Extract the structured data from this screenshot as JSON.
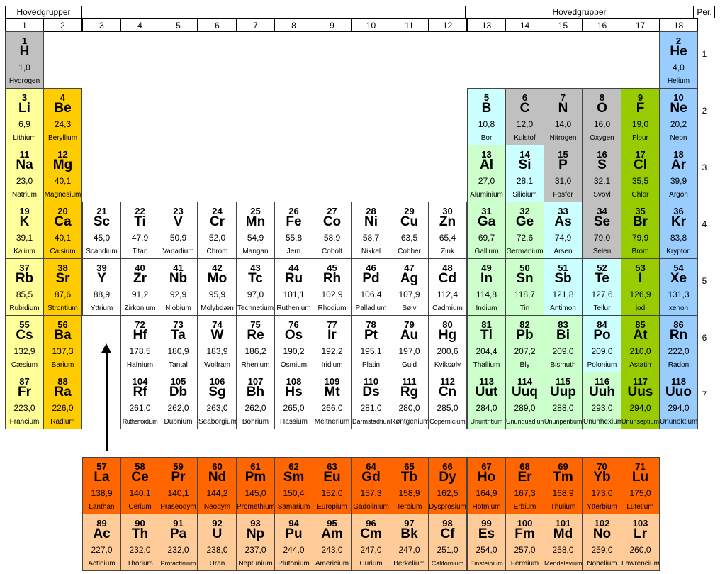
{
  "headers": {
    "left_group": "Hovedgrupper",
    "right_group": "Hovedgrupper",
    "period": "Per."
  },
  "groups": [
    "1",
    "2",
    "3",
    "4",
    "5",
    "6",
    "7",
    "8",
    "9",
    "10",
    "11",
    "12",
    "13",
    "14",
    "15",
    "16",
    "17",
    "18"
  ],
  "periods": [
    "1",
    "2",
    "3",
    "4",
    "5",
    "6",
    "7"
  ],
  "colors": {
    "hydrogen": "#c0c0c0",
    "alkali": "#ffff99",
    "alkaline": "#ffcc00",
    "transition": "#ffffff",
    "boron_group": "#ccffff",
    "metalloid": "#c0c0c0",
    "poor_metal": "#ccffcc",
    "halogen": "#99cc00",
    "noble": "#99ccff",
    "lanthanide": "#ff6600",
    "actinide": "#ffcc99"
  },
  "elements": [
    {
      "n": "1",
      "s": "H",
      "m": "1,0",
      "name": "Hydrogen",
      "g": 1,
      "p": 1,
      "c": "hydrogen"
    },
    {
      "n": "2",
      "s": "He",
      "m": "4,0",
      "name": "Helium",
      "g": 18,
      "p": 1,
      "c": "noble"
    },
    {
      "n": "3",
      "s": "Li",
      "m": "6,9",
      "name": "Lithium",
      "g": 1,
      "p": 2,
      "c": "alkali"
    },
    {
      "n": "4",
      "s": "Be",
      "m": "24,3",
      "name": "Beryllium",
      "g": 2,
      "p": 2,
      "c": "alkaline"
    },
    {
      "n": "5",
      "s": "B",
      "m": "10,8",
      "name": "Bor",
      "g": 13,
      "p": 2,
      "c": "boron_group"
    },
    {
      "n": "6",
      "s": "C",
      "m": "12,0",
      "name": "Kulstof",
      "g": 14,
      "p": 2,
      "c": "metalloid"
    },
    {
      "n": "7",
      "s": "N",
      "m": "14,0",
      "name": "Nitrogen",
      "g": 15,
      "p": 2,
      "c": "metalloid"
    },
    {
      "n": "8",
      "s": "O",
      "m": "16,0",
      "name": "Oxygen",
      "g": 16,
      "p": 2,
      "c": "metalloid"
    },
    {
      "n": "9",
      "s": "F",
      "m": "19,0",
      "name": "Flour",
      "g": 17,
      "p": 2,
      "c": "halogen"
    },
    {
      "n": "10",
      "s": "Ne",
      "m": "20,2",
      "name": "Neon",
      "g": 18,
      "p": 2,
      "c": "noble"
    },
    {
      "n": "11",
      "s": "Na",
      "m": "23,0",
      "name": "Natrium",
      "g": 1,
      "p": 3,
      "c": "alkali"
    },
    {
      "n": "12",
      "s": "Mg",
      "m": "40,1",
      "name": "Magnesium",
      "g": 2,
      "p": 3,
      "c": "alkaline"
    },
    {
      "n": "13",
      "s": "Al",
      "m": "27,0",
      "name": "Aluminium",
      "g": 13,
      "p": 3,
      "c": "poor_metal"
    },
    {
      "n": "14",
      "s": "Si",
      "m": "28,1",
      "name": "Silicium",
      "g": 14,
      "p": 3,
      "c": "boron_group"
    },
    {
      "n": "15",
      "s": "P",
      "m": "31,0",
      "name": "Fosfor",
      "g": 15,
      "p": 3,
      "c": "metalloid"
    },
    {
      "n": "16",
      "s": "S",
      "m": "32,1",
      "name": "Svovl",
      "g": 16,
      "p": 3,
      "c": "metalloid"
    },
    {
      "n": "17",
      "s": "Cl",
      "m": "35,5",
      "name": "Chlor",
      "g": 17,
      "p": 3,
      "c": "halogen"
    },
    {
      "n": "18",
      "s": "Ar",
      "m": "39,9",
      "name": "Argon",
      "g": 18,
      "p": 3,
      "c": "noble"
    },
    {
      "n": "19",
      "s": "K",
      "m": "39,1",
      "name": "Kalium",
      "g": 1,
      "p": 4,
      "c": "alkali"
    },
    {
      "n": "20",
      "s": "Ca",
      "m": "40,1",
      "name": "Calsium",
      "g": 2,
      "p": 4,
      "c": "alkaline"
    },
    {
      "n": "21",
      "s": "Sc",
      "m": "45,0",
      "name": "Scandium",
      "g": 3,
      "p": 4,
      "c": "transition"
    },
    {
      "n": "22",
      "s": "Ti",
      "m": "47,9",
      "name": "Titan",
      "g": 4,
      "p": 4,
      "c": "transition"
    },
    {
      "n": "23",
      "s": "V",
      "m": "50,9",
      "name": "Vanadium",
      "g": 5,
      "p": 4,
      "c": "transition"
    },
    {
      "n": "24",
      "s": "Cr",
      "m": "52,0",
      "name": "Chrom",
      "g": 6,
      "p": 4,
      "c": "transition"
    },
    {
      "n": "25",
      "s": "Mn",
      "m": "54,9",
      "name": "Mangan",
      "g": 7,
      "p": 4,
      "c": "transition"
    },
    {
      "n": "26",
      "s": "Fe",
      "m": "55,8",
      "name": "Jern",
      "g": 8,
      "p": 4,
      "c": "transition"
    },
    {
      "n": "27",
      "s": "Co",
      "m": "58,9",
      "name": "Cobolt",
      "g": 9,
      "p": 4,
      "c": "transition"
    },
    {
      "n": "28",
      "s": "Ni",
      "m": "58,7",
      "name": "Nikkel",
      "g": 10,
      "p": 4,
      "c": "transition"
    },
    {
      "n": "29",
      "s": "Cu",
      "m": "63,5",
      "name": "Cobber",
      "g": 11,
      "p": 4,
      "c": "transition"
    },
    {
      "n": "30",
      "s": "Zn",
      "m": "65,4",
      "name": "Zink",
      "g": 12,
      "p": 4,
      "c": "transition"
    },
    {
      "n": "31",
      "s": "Ga",
      "m": "69,7",
      "name": "Gallium",
      "g": 13,
      "p": 4,
      "c": "poor_metal"
    },
    {
      "n": "32",
      "s": "Ge",
      "m": "72,6",
      "name": "Germanium",
      "g": 14,
      "p": 4,
      "c": "poor_metal"
    },
    {
      "n": "33",
      "s": "As",
      "m": "74,9",
      "name": "Arsen",
      "g": 15,
      "p": 4,
      "c": "boron_group"
    },
    {
      "n": "34",
      "s": "Se",
      "m": "79,0",
      "name": "Selen",
      "g": 16,
      "p": 4,
      "c": "metalloid"
    },
    {
      "n": "35",
      "s": "Br",
      "m": "79,9",
      "name": "Brom",
      "g": 17,
      "p": 4,
      "c": "halogen"
    },
    {
      "n": "36",
      "s": "Kr",
      "m": "83,8",
      "name": "Krypton",
      "g": 18,
      "p": 4,
      "c": "noble"
    },
    {
      "n": "37",
      "s": "Rb",
      "m": "85,5",
      "name": "Rubidium",
      "g": 1,
      "p": 5,
      "c": "alkali"
    },
    {
      "n": "38",
      "s": "Sr",
      "m": "87,6",
      "name": "Strontium",
      "g": 2,
      "p": 5,
      "c": "alkaline"
    },
    {
      "n": "39",
      "s": "Y",
      "m": "88,9",
      "name": "Yttrium",
      "g": 3,
      "p": 5,
      "c": "transition"
    },
    {
      "n": "40",
      "s": "Zr",
      "m": "91,2",
      "name": "Zirkonium",
      "g": 4,
      "p": 5,
      "c": "transition"
    },
    {
      "n": "41",
      "s": "Nb",
      "m": "92,9",
      "name": "Niobium",
      "g": 5,
      "p": 5,
      "c": "transition"
    },
    {
      "n": "42",
      "s": "Mo",
      "m": "95,9",
      "name": "Molybdæn",
      "g": 6,
      "p": 5,
      "c": "transition"
    },
    {
      "n": "43",
      "s": "Tc",
      "m": "97,0",
      "name": "Technetium",
      "g": 7,
      "p": 5,
      "c": "transition"
    },
    {
      "n": "44",
      "s": "Ru",
      "m": "101,1",
      "name": "Ruthenium",
      "g": 8,
      "p": 5,
      "c": "transition"
    },
    {
      "n": "45",
      "s": "Rh",
      "m": "102,9",
      "name": "Rhodium",
      "g": 9,
      "p": 5,
      "c": "transition"
    },
    {
      "n": "46",
      "s": "Pd",
      "m": "106,4",
      "name": "Palladium",
      "g": 10,
      "p": 5,
      "c": "transition"
    },
    {
      "n": "47",
      "s": "Ag",
      "m": "107,9",
      "name": "Sølv",
      "g": 11,
      "p": 5,
      "c": "transition"
    },
    {
      "n": "48",
      "s": "Cd",
      "m": "112,4",
      "name": "Cadmium",
      "g": 12,
      "p": 5,
      "c": "transition"
    },
    {
      "n": "49",
      "s": "In",
      "m": "114,8",
      "name": "Indium",
      "g": 13,
      "p": 5,
      "c": "poor_metal"
    },
    {
      "n": "50",
      "s": "Sn",
      "m": "118,7",
      "name": "Tin",
      "g": 14,
      "p": 5,
      "c": "poor_metal"
    },
    {
      "n": "51",
      "s": "Sb",
      "m": "121,8",
      "name": "Antimon",
      "g": 15,
      "p": 5,
      "c": "boron_group"
    },
    {
      "n": "52",
      "s": "Te",
      "m": "127,6",
      "name": "Tellur",
      "g": 16,
      "p": 5,
      "c": "boron_group"
    },
    {
      "n": "53",
      "s": "I",
      "m": "126,9",
      "name": "jod",
      "g": 17,
      "p": 5,
      "c": "halogen"
    },
    {
      "n": "54",
      "s": "Xe",
      "m": "131,3",
      "name": "xenon",
      "g": 18,
      "p": 5,
      "c": "noble"
    },
    {
      "n": "55",
      "s": "Cs",
      "m": "132,9",
      "name": "Cæsium",
      "g": 1,
      "p": 6,
      "c": "alkali"
    },
    {
      "n": "56",
      "s": "Ba",
      "m": "137,3",
      "name": "Barium",
      "g": 2,
      "p": 6,
      "c": "alkaline"
    },
    {
      "n": "72",
      "s": "Hf",
      "m": "178,5",
      "name": "Hafnium",
      "g": 4,
      "p": 6,
      "c": "transition"
    },
    {
      "n": "73",
      "s": "Ta",
      "m": "180,9",
      "name": "Tantal",
      "g": 5,
      "p": 6,
      "c": "transition"
    },
    {
      "n": "74",
      "s": "W",
      "m": "183,9",
      "name": "Wolfram",
      "g": 6,
      "p": 6,
      "c": "transition"
    },
    {
      "n": "75",
      "s": "Re",
      "m": "186,2",
      "name": "Rhenium",
      "g": 7,
      "p": 6,
      "c": "transition"
    },
    {
      "n": "76",
      "s": "Os",
      "m": "190,2",
      "name": "Osmium",
      "g": 8,
      "p": 6,
      "c": "transition"
    },
    {
      "n": "77",
      "s": "Ir",
      "m": "192,2",
      "name": "Iridium",
      "g": 9,
      "p": 6,
      "c": "transition"
    },
    {
      "n": "78",
      "s": "Pt",
      "m": "195,1",
      "name": "Platin",
      "g": 10,
      "p": 6,
      "c": "transition"
    },
    {
      "n": "79",
      "s": "Au",
      "m": "197,0",
      "name": "Guld",
      "g": 11,
      "p": 6,
      "c": "transition"
    },
    {
      "n": "80",
      "s": "Hg",
      "m": "200,6",
      "name": "Kviksølv",
      "g": 12,
      "p": 6,
      "c": "transition"
    },
    {
      "n": "81",
      "s": "Tl",
      "m": "204,4",
      "name": "Thallium",
      "g": 13,
      "p": 6,
      "c": "poor_metal"
    },
    {
      "n": "82",
      "s": "Pb",
      "m": "207,2",
      "name": "Bly",
      "g": 14,
      "p": 6,
      "c": "poor_metal"
    },
    {
      "n": "83",
      "s": "Bi",
      "m": "209,0",
      "name": "Bismuth",
      "g": 15,
      "p": 6,
      "c": "poor_metal"
    },
    {
      "n": "84",
      "s": "Po",
      "m": "209,0",
      "name": "Polonium",
      "g": 16,
      "p": 6,
      "c": "boron_group"
    },
    {
      "n": "85",
      "s": "At",
      "m": "210,0",
      "name": "Astatin",
      "g": 17,
      "p": 6,
      "c": "halogen"
    },
    {
      "n": "86",
      "s": "Rn",
      "m": "222,0",
      "name": "Radon",
      "g": 18,
      "p": 6,
      "c": "noble"
    },
    {
      "n": "87",
      "s": "Fr",
      "m": "223,0",
      "name": "Francium",
      "g": 1,
      "p": 7,
      "c": "alkali"
    },
    {
      "n": "88",
      "s": "Ra",
      "m": "226,0",
      "name": "Radium",
      "g": 2,
      "p": 7,
      "c": "alkaline"
    },
    {
      "n": "104",
      "s": "Rf",
      "m": "261,0",
      "name": "Rutherfordium",
      "g": 4,
      "p": 7,
      "c": "transition"
    },
    {
      "n": "105",
      "s": "Db",
      "m": "262,0",
      "name": "Dubnium",
      "g": 5,
      "p": 7,
      "c": "transition"
    },
    {
      "n": "106",
      "s": "Sg",
      "m": "263,0",
      "name": "Seaborgium",
      "g": 6,
      "p": 7,
      "c": "transition"
    },
    {
      "n": "107",
      "s": "Bh",
      "m": "262,0",
      "name": "Bohrium",
      "g": 7,
      "p": 7,
      "c": "transition"
    },
    {
      "n": "108",
      "s": "Hs",
      "m": "265,0",
      "name": "Hassium",
      "g": 8,
      "p": 7,
      "c": "transition"
    },
    {
      "n": "109",
      "s": "Mt",
      "m": "266,0",
      "name": "Meitnerium",
      "g": 9,
      "p": 7,
      "c": "transition"
    },
    {
      "n": "110",
      "s": "Ds",
      "m": "281,0",
      "name": "Darmstadtium",
      "g": 10,
      "p": 7,
      "c": "transition"
    },
    {
      "n": "111",
      "s": "Rg",
      "m": "280,0",
      "name": "Røntgenium",
      "g": 11,
      "p": 7,
      "c": "transition"
    },
    {
      "n": "112",
      "s": "Cn",
      "m": "285,0",
      "name": "Copernicium",
      "g": 12,
      "p": 7,
      "c": "transition"
    },
    {
      "n": "113",
      "s": "Uut",
      "m": "284,0",
      "name": "Ununtritium",
      "g": 13,
      "p": 7,
      "c": "poor_metal"
    },
    {
      "n": "114",
      "s": "Uuq",
      "m": "289,0",
      "name": "Ununquadium",
      "g": 14,
      "p": 7,
      "c": "poor_metal"
    },
    {
      "n": "115",
      "s": "Uup",
      "m": "288,0",
      "name": "Ununpentium",
      "g": 15,
      "p": 7,
      "c": "poor_metal"
    },
    {
      "n": "116",
      "s": "Uuh",
      "m": "293,0",
      "name": "Ununhexium",
      "g": 16,
      "p": 7,
      "c": "poor_metal"
    },
    {
      "n": "117",
      "s": "Uus",
      "m": "294,0",
      "name": "Ununseptium",
      "g": 17,
      "p": 7,
      "c": "halogen"
    },
    {
      "n": "118",
      "s": "Uuo",
      "m": "294,0",
      "name": "Ununoktium",
      "g": 18,
      "p": 7,
      "c": "noble"
    },
    {
      "n": "57",
      "s": "La",
      "m": "138,9",
      "name": "Lanthan",
      "g": 3,
      "p": 9,
      "c": "lanthanide"
    },
    {
      "n": "58",
      "s": "Ce",
      "m": "140,1",
      "name": "Cerium",
      "g": 4,
      "p": 9,
      "c": "lanthanide"
    },
    {
      "n": "59",
      "s": "Pr",
      "m": "140,1",
      "name": "Praseodym",
      "g": 5,
      "p": 9,
      "c": "lanthanide"
    },
    {
      "n": "60",
      "s": "Nd",
      "m": "144,2",
      "name": "Neodym",
      "g": 6,
      "p": 9,
      "c": "lanthanide"
    },
    {
      "n": "61",
      "s": "Pm",
      "m": "145,0",
      "name": "Promethium",
      "g": 7,
      "p": 9,
      "c": "lanthanide"
    },
    {
      "n": "62",
      "s": "Sm",
      "m": "150,4",
      "name": "Samarium",
      "g": 8,
      "p": 9,
      "c": "lanthanide"
    },
    {
      "n": "63",
      "s": "Eu",
      "m": "152,0",
      "name": "Europium",
      "g": 9,
      "p": 9,
      "c": "lanthanide"
    },
    {
      "n": "64",
      "s": "Gd",
      "m": "157,3",
      "name": "Gadolinium",
      "g": 10,
      "p": 9,
      "c": "lanthanide"
    },
    {
      "n": "65",
      "s": "Tb",
      "m": "158,9",
      "name": "Terbium",
      "g": 11,
      "p": 9,
      "c": "lanthanide"
    },
    {
      "n": "66",
      "s": "Dy",
      "m": "162,5",
      "name": "Dysprosium",
      "g": 12,
      "p": 9,
      "c": "lanthanide"
    },
    {
      "n": "67",
      "s": "Ho",
      "m": "164,9",
      "name": "Hofmium",
      "g": 13,
      "p": 9,
      "c": "lanthanide"
    },
    {
      "n": "68",
      "s": "Er",
      "m": "167,3",
      "name": "Erbium",
      "g": 14,
      "p": 9,
      "c": "lanthanide"
    },
    {
      "n": "69",
      "s": "Tm",
      "m": "168,9",
      "name": "Thulium",
      "g": 15,
      "p": 9,
      "c": "lanthanide"
    },
    {
      "n": "70",
      "s": "Yb",
      "m": "173,0",
      "name": "Ytterbium",
      "g": 16,
      "p": 9,
      "c": "lanthanide"
    },
    {
      "n": "71",
      "s": "Lu",
      "m": "175,0",
      "name": "Lutetium",
      "g": 17,
      "p": 9,
      "c": "lanthanide"
    },
    {
      "n": "89",
      "s": "Ac",
      "m": "227,0",
      "name": "Actinium",
      "g": 3,
      "p": 10,
      "c": "actinide"
    },
    {
      "n": "90",
      "s": "Th",
      "m": "232,0",
      "name": "Thorium",
      "g": 4,
      "p": 10,
      "c": "actinide"
    },
    {
      "n": "91",
      "s": "Pa",
      "m": "232,0",
      "name": "Protactinium",
      "g": 5,
      "p": 10,
      "c": "actinide"
    },
    {
      "n": "92",
      "s": "U",
      "m": "238,0",
      "name": "Uran",
      "g": 6,
      "p": 10,
      "c": "actinide"
    },
    {
      "n": "93",
      "s": "Np",
      "m": "237,0",
      "name": "Neptunium",
      "g": 7,
      "p": 10,
      "c": "actinide"
    },
    {
      "n": "94",
      "s": "Pu",
      "m": "244,0",
      "name": "Plutonium",
      "g": 8,
      "p": 10,
      "c": "actinide"
    },
    {
      "n": "95",
      "s": "Am",
      "m": "243,0",
      "name": "Americium",
      "g": 9,
      "p": 10,
      "c": "actinide"
    },
    {
      "n": "96",
      "s": "Cm",
      "m": "247,0",
      "name": "Curium",
      "g": 10,
      "p": 10,
      "c": "actinide"
    },
    {
      "n": "97",
      "s": "Bk",
      "m": "247,0",
      "name": "Berkelium",
      "g": 11,
      "p": 10,
      "c": "actinide"
    },
    {
      "n": "98",
      "s": "Cf",
      "m": "251,0",
      "name": "Californium",
      "g": 12,
      "p": 10,
      "c": "actinide"
    },
    {
      "n": "99",
      "s": "Es",
      "m": "254,0",
      "name": "Einsteinium",
      "g": 13,
      "p": 10,
      "c": "actinide"
    },
    {
      "n": "100",
      "s": "Fm",
      "m": "257,0",
      "name": "Fermium",
      "g": 14,
      "p": 10,
      "c": "actinide"
    },
    {
      "n": "101",
      "s": "Md",
      "m": "258,0",
      "name": "Mendelevium",
      "g": 15,
      "p": 10,
      "c": "actinide"
    },
    {
      "n": "102",
      "s": "No",
      "m": "259,0",
      "name": "Nobelium",
      "g": 16,
      "p": 10,
      "c": "actinide"
    },
    {
      "n": "103",
      "s": "Lr",
      "m": "260,0",
      "name": "Lawrencium",
      "g": 17,
      "p": 10,
      "c": "actinide"
    }
  ]
}
